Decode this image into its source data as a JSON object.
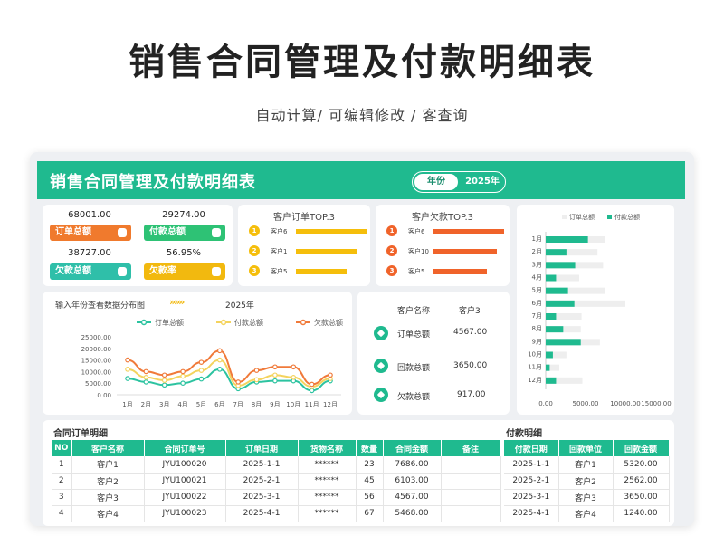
{
  "hero": {
    "title": "销售合同管理及付款明细表",
    "subtitle": "自动计算/  可编辑修改  / 客查询"
  },
  "header": {
    "title": "销售合同管理及付款明细表",
    "year_label": "年份",
    "year_value": "2025年"
  },
  "kpis": [
    {
      "value": "68001.00",
      "label": "订单总额",
      "color": "#f07a2d"
    },
    {
      "value": "29274.00",
      "label": "付款总额",
      "color": "#2ec275"
    },
    {
      "value": "38727.00",
      "label": "欠款总额",
      "color": "#2fbfa9"
    },
    {
      "value": "56.95%",
      "label": "欠款率",
      "color": "#f2b90f"
    }
  ],
  "top_orders": {
    "title": "客户订单TOP.3",
    "color": "#f5be0b",
    "items": [
      {
        "rank": "1",
        "name": "客户6",
        "value": 8900
      },
      {
        "rank": "2",
        "name": "客户1",
        "value": 7686
      },
      {
        "rank": "3",
        "name": "客户5",
        "value": 6400
      }
    ]
  },
  "top_debts": {
    "title": "客户欠款TOP.3",
    "color": "#f0632a",
    "items": [
      {
        "rank": "1",
        "name": "客户6",
        "value": 6000
      },
      {
        "rank": "2",
        "name": "客户10",
        "value": 5400
      },
      {
        "rank": "3",
        "name": "客户5",
        "value": 4500
      }
    ]
  },
  "line_panel": {
    "caption": "输入年份查看数据分布图",
    "arrows": "»»»",
    "year": "2025年"
  },
  "chart_data": [
    {
      "type": "line",
      "categories": [
        "1月",
        "2月",
        "3月",
        "4月",
        "5月",
        "6月",
        "7月",
        "8月",
        "9月",
        "10月",
        "11月",
        "12月"
      ],
      "series": [
        {
          "name": "订单总额",
          "color": "#2cc3a0",
          "values": [
            7000,
            5500,
            4200,
            5000,
            6800,
            11000,
            2600,
            5500,
            6000,
            6000,
            1800,
            6000
          ]
        },
        {
          "name": "付款总额",
          "color": "#f4d35e",
          "values": [
            11000,
            7500,
            6200,
            8000,
            10500,
            15000,
            4000,
            6500,
            8500,
            7500,
            3500,
            7000
          ]
        },
        {
          "name": "欠款总额",
          "color": "#f07a3a",
          "values": [
            15000,
            10000,
            8500,
            10000,
            14000,
            19000,
            5500,
            10500,
            12000,
            12000,
            4500,
            8500
          ]
        }
      ],
      "yticks": [
        "25000.00",
        "20000.00",
        "15000.00",
        "10000.00",
        "5000.00",
        "0.00"
      ],
      "ylim": [
        0,
        25000
      ]
    },
    {
      "type": "bar",
      "orientation": "horizontal",
      "legend": [
        "订单总额",
        "付款总额"
      ],
      "categories": [
        "1月",
        "2月",
        "3月",
        "4月",
        "5月",
        "6月",
        "7月",
        "8月",
        "9月",
        "10月",
        "11月",
        "12月"
      ],
      "series": [
        {
          "name": "订单总额",
          "color": "#eeeeee",
          "values": [
            7500,
            6500,
            7200,
            4200,
            7500,
            10000,
            4500,
            4400,
            6800,
            2600,
            1700,
            4600
          ]
        },
        {
          "name": "付款总额",
          "color": "#1fba8f",
          "values": [
            5300,
            2600,
            3700,
            1300,
            2800,
            3600,
            1300,
            2200,
            4400,
            900,
            500,
            1300
          ]
        }
      ],
      "xticks": [
        "0.00",
        "5000.00",
        "10000.00",
        "15000.00"
      ],
      "xlim": [
        0,
        15000
      ]
    }
  ],
  "customer_panel": {
    "col1": "客户名称",
    "col2": "客户3",
    "rows": [
      {
        "label": "订单总额",
        "value": "4567.00"
      },
      {
        "label": "回款总额",
        "value": "3650.00"
      },
      {
        "label": "欠款总额",
        "value": "917.00"
      }
    ]
  },
  "contracts": {
    "title": "合同订单明细",
    "headers": [
      "NO",
      "客户名称",
      "合同订单号",
      "订单日期",
      "货物名称",
      "数量",
      "合同金额",
      "备注"
    ],
    "rows": [
      [
        "1",
        "客户1",
        "JYU100020",
        "2025-1-1",
        "******",
        "23",
        "7686.00",
        ""
      ],
      [
        "2",
        "客户2",
        "JYU100021",
        "2025-2-1",
        "******",
        "45",
        "6103.00",
        ""
      ],
      [
        "3",
        "客户3",
        "JYU100022",
        "2025-3-1",
        "******",
        "56",
        "4567.00",
        ""
      ],
      [
        "4",
        "客户4",
        "JYU100023",
        "2025-4-1",
        "******",
        "67",
        "5468.00",
        ""
      ]
    ]
  },
  "payments": {
    "title": "付款明细",
    "headers": [
      "付款日期",
      "回款单位",
      "回款金额"
    ],
    "rows": [
      [
        "2025-1-1",
        "客户1",
        "5320.00"
      ],
      [
        "2025-2-1",
        "客户2",
        "2562.00"
      ],
      [
        "2025-3-1",
        "客户3",
        "3650.00"
      ],
      [
        "2025-4-1",
        "客户4",
        "1240.00"
      ]
    ]
  }
}
